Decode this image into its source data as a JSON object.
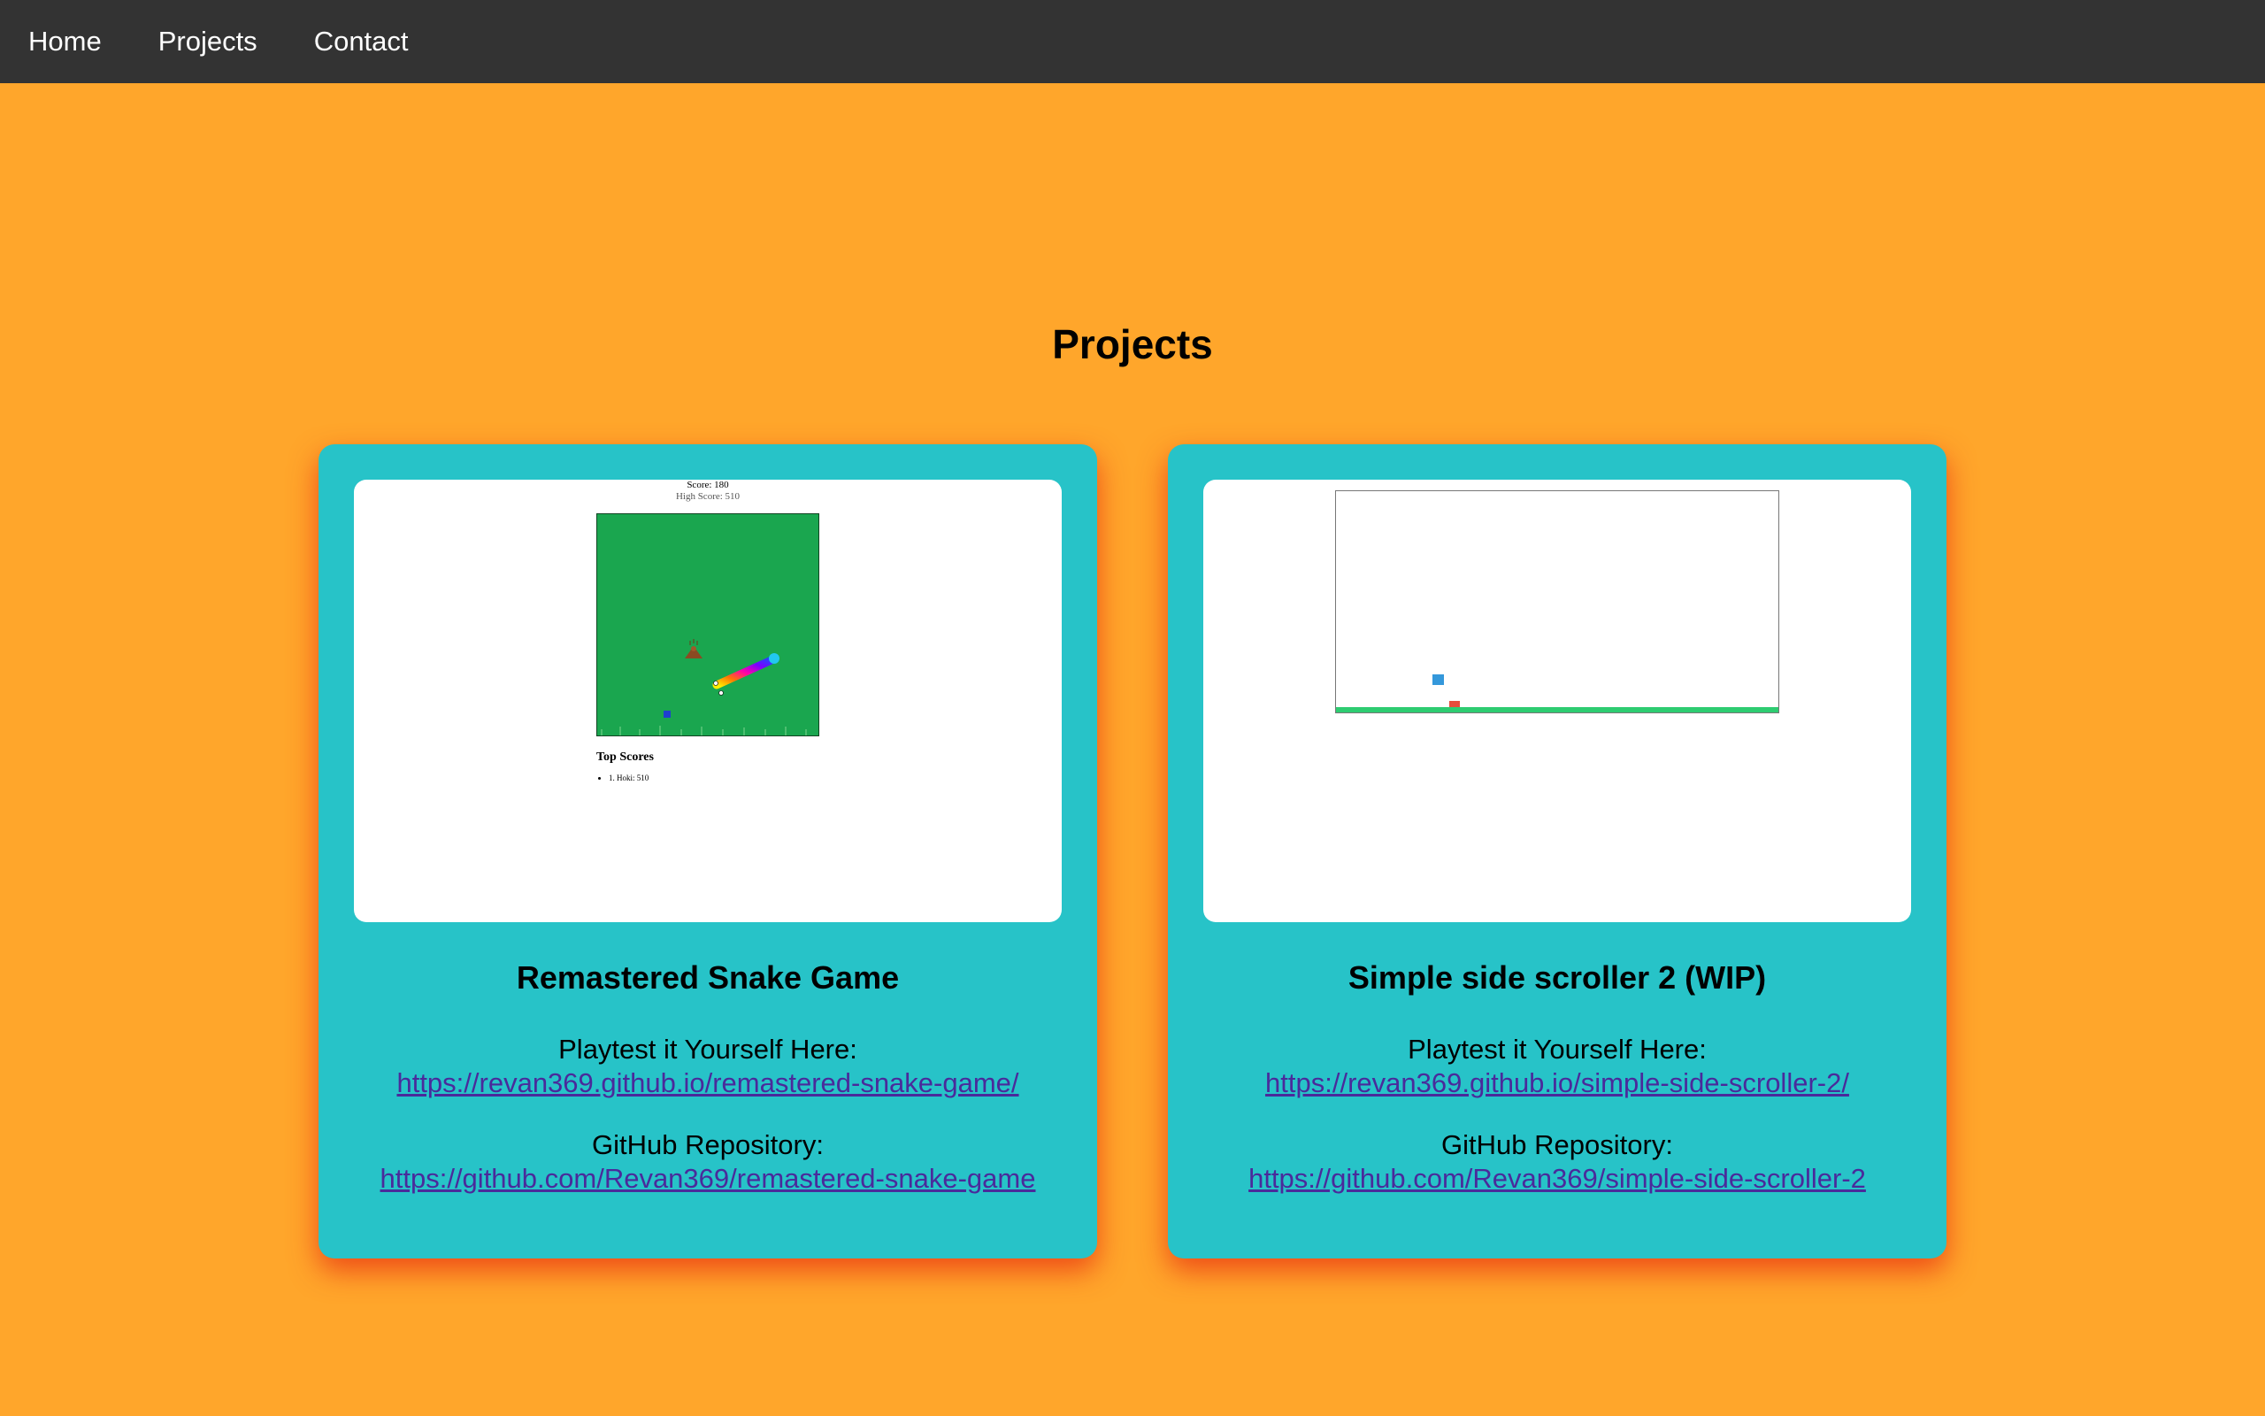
{
  "nav": {
    "items": [
      {
        "label": "Home"
      },
      {
        "label": "Projects"
      },
      {
        "label": "Contact"
      }
    ]
  },
  "page": {
    "title": "Projects"
  },
  "projects": [
    {
      "title": "Remastered Snake Game",
      "playtest_label": "Playtest it Yourself Here:",
      "playtest_url": "https://revan369.github.io/remastered-snake-game/",
      "repo_label": "GitHub Repository:",
      "repo_url": "https://github.com/Revan369/remastered-snake-game",
      "preview": {
        "score_text": "Score: 180",
        "high_score_text": "High Score: 510",
        "top_scores_title": "Top Scores",
        "top_scores": [
          "1. Hoki: 510"
        ],
        "board_color": "#1aa64f"
      }
    },
    {
      "title": "Simple side scroller 2 (WIP)",
      "playtest_label": "Playtest it Yourself Here:",
      "playtest_url": "https://revan369.github.io/simple-side-scroller-2/",
      "repo_label": "GitHub Repository:",
      "repo_url": "https://github.com/Revan369/simple-side-scroller-2",
      "preview": {
        "ground_color": "#2ecc71",
        "player_color": "#3498db",
        "enemy_color": "#e74c3c"
      }
    }
  ],
  "colors": {
    "background": "#ffa62b",
    "navbar": "#333333",
    "card": "#27c3c8",
    "link": "#4a2a9b"
  }
}
